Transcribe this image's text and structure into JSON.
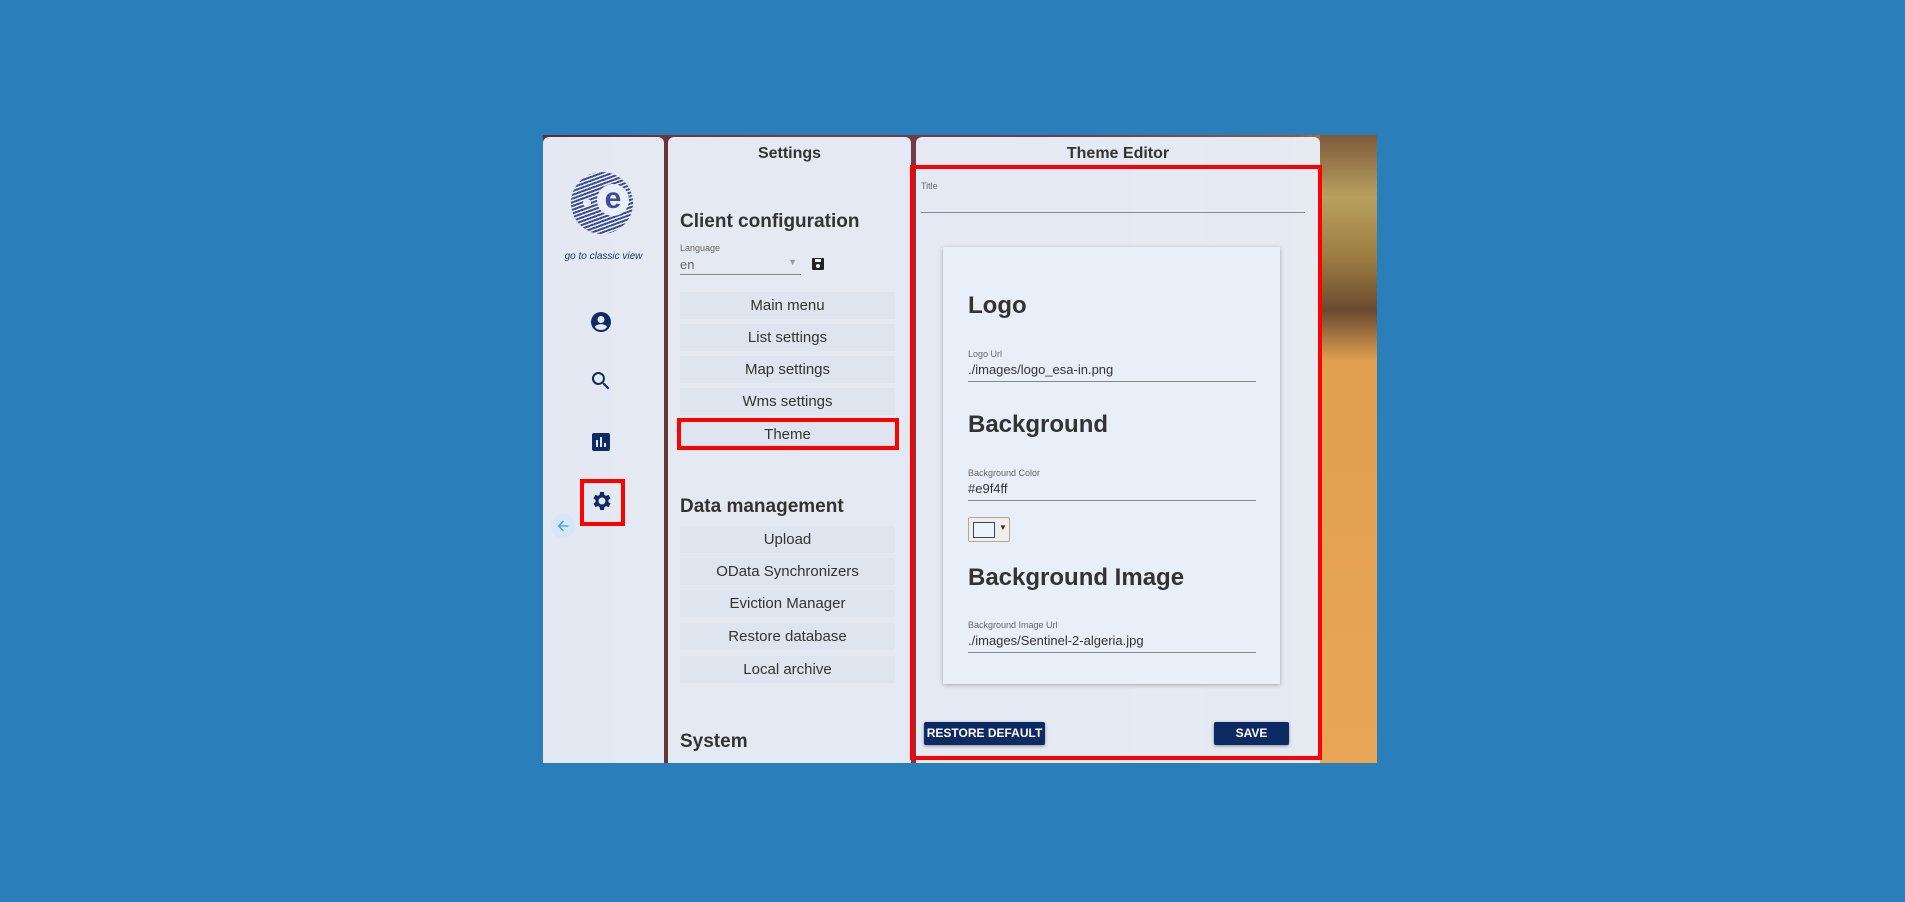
{
  "sidebar": {
    "classic_link": "go to classic view",
    "icons": [
      "account-icon",
      "search-icon",
      "chart-icon",
      "gear-icon",
      "arrow-left-icon"
    ]
  },
  "settings": {
    "title": "Settings",
    "client_config": {
      "heading": "Client configuration",
      "language_label": "Language",
      "language_value": "en",
      "items": [
        "Main menu",
        "List settings",
        "Map settings",
        "Wms settings",
        "Theme"
      ]
    },
    "data_management": {
      "heading": "Data management",
      "items": [
        "Upload",
        "OData Synchronizers",
        "Eviction Manager",
        "Restore database",
        "Local archive"
      ]
    },
    "system": {
      "heading": "System"
    }
  },
  "editor": {
    "title": "Theme Editor",
    "title_field_label": "Title",
    "title_field_value": "",
    "logo_heading": "Logo",
    "logo_url_label": "Logo Url",
    "logo_url_value": "./images/logo_esa-in.png",
    "background_heading": "Background",
    "bg_color_label": "Background Color",
    "bg_color_value": "#e9f4ff",
    "bg_image_heading": "Background Image",
    "bg_image_label": "Background Image Url",
    "bg_image_value": "./images/Sentinel-2-algeria.jpg",
    "restore_label": "RESTORE DEFAULT",
    "save_label": "SAVE"
  },
  "colors": {
    "accent": "#0d2a63",
    "highlight": "#ff0000",
    "page_bg": "#2a7fba"
  }
}
